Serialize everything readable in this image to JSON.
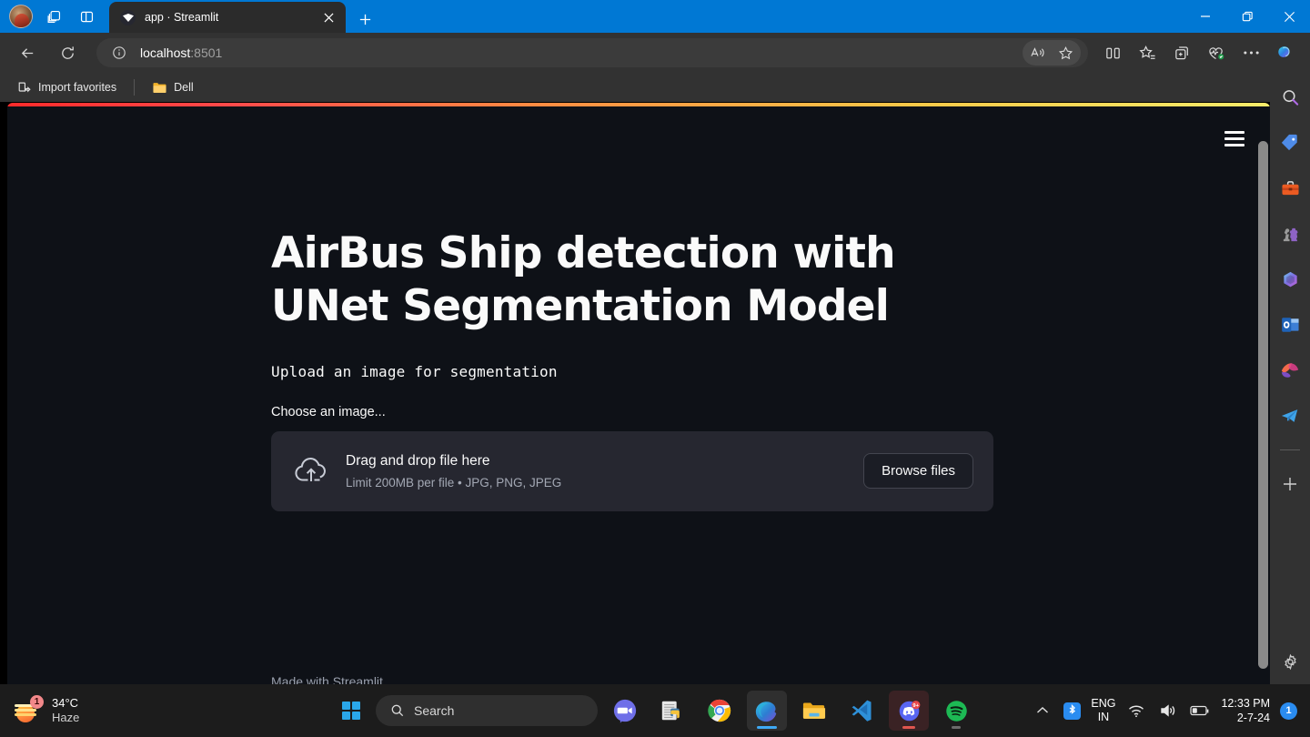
{
  "browser": {
    "tab": {
      "title": "app · Streamlit",
      "favicon": "streamlit-icon",
      "close_label": "×"
    },
    "new_tab_label": "+",
    "address": {
      "url_host": "localhost",
      "url_port": ":8501",
      "info_icon": "info-circle-icon"
    },
    "window_controls": {
      "minimize": "minimize-icon",
      "maximize": "restore-icon",
      "close": "close-icon"
    },
    "bookmarks": [
      {
        "label": "Import favorites",
        "icon": "import-favorites-icon"
      },
      {
        "label": "Dell",
        "icon": "folder-icon"
      }
    ],
    "toolbar_icons": [
      "read-aloud-icon",
      "favorite-star-icon",
      "split-screen-icon",
      "collections-star-icon",
      "add-to-collection-icon",
      "browser-essentials-icon",
      "more-options-icon",
      "copilot-icon"
    ],
    "nav_icons": [
      "back-arrow-icon",
      "refresh-icon"
    ],
    "titlebar_icons": [
      "profile-avatar",
      "tab-groups-icon",
      "split-pane-icon"
    ],
    "sidebar_icons": [
      "search-icon",
      "shopping-tag-icon",
      "tools-icon",
      "games-icon",
      "microsoft-365-icon",
      "outlook-icon",
      "designer-icon",
      "telegram-icon",
      "add-sidebar-app-icon",
      "settings-gear-icon"
    ]
  },
  "page": {
    "title": "AirBus Ship detection with UNet Segmentation Model",
    "subtitle": "Upload an image for segmentation",
    "uploader": {
      "label": "Choose an image...",
      "drag_text": "Drag and drop file here",
      "limit_text": "Limit 200MB per file • JPG, PNG, JPEG",
      "browse_label": "Browse files",
      "icon": "cloud-upload-icon"
    },
    "footer": "Made with Streamlit",
    "menu_icon": "hamburger-menu-icon",
    "accent_gradient": [
      "#ff2b2b",
      "#ff8c42",
      "#f6ec6a"
    ],
    "background_color": "#0E1117",
    "surface_color": "#262730"
  },
  "taskbar": {
    "weather": {
      "temperature": "34°C",
      "condition": "Haze",
      "badge": "1",
      "icon": "haze-sun-icon"
    },
    "start_label": "start-button",
    "search": {
      "placeholder": "Search",
      "icon": "search-icon"
    },
    "apps": [
      {
        "name": "zoom-icon",
        "label": "Zoom"
      },
      {
        "name": "python-idle-icon",
        "label": "Python IDLE"
      },
      {
        "name": "chrome-icon",
        "label": "Google Chrome"
      },
      {
        "name": "edge-icon",
        "label": "Microsoft Edge"
      },
      {
        "name": "file-explorer-icon",
        "label": "File Explorer"
      },
      {
        "name": "vscode-icon",
        "label": "Visual Studio Code"
      },
      {
        "name": "discord-icon",
        "label": "Discord",
        "badge": "9+"
      },
      {
        "name": "spotify-icon",
        "label": "Spotify"
      }
    ],
    "tray": {
      "chevron": "show-hidden-icons-icon",
      "bluetooth": "bluetooth-icon",
      "language_primary": "ENG",
      "language_secondary": "IN",
      "wifi": "wifi-icon",
      "volume": "volume-icon",
      "battery": "battery-icon",
      "time": "12:33 PM",
      "date": "2-7-24",
      "notification_badge": "1"
    }
  }
}
